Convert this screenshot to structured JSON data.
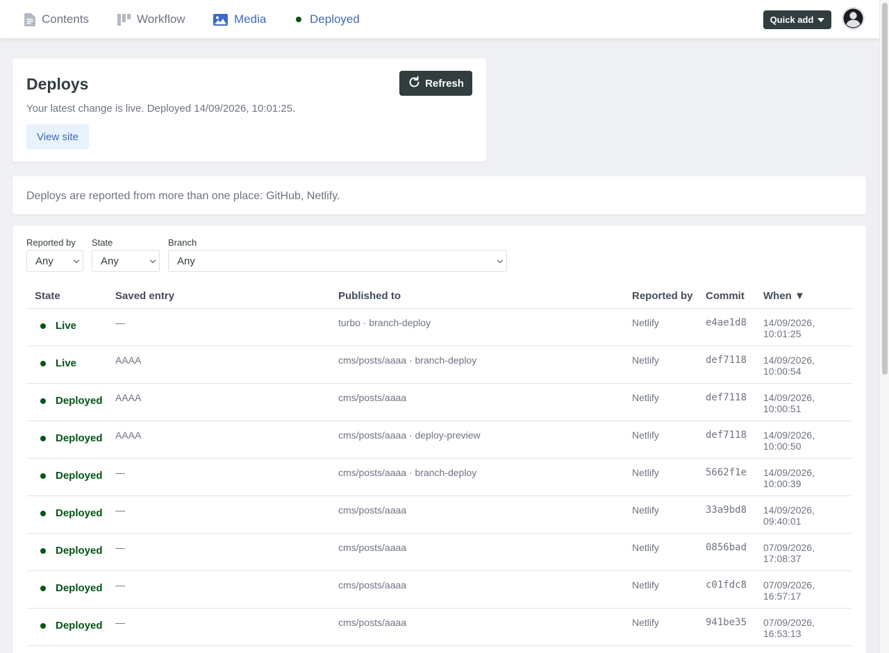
{
  "nav": {
    "items": [
      {
        "label": "Contents",
        "icon": "document-icon"
      },
      {
        "label": "Workflow",
        "icon": "workflow-icon"
      },
      {
        "label": "Media",
        "icon": "image-icon"
      },
      {
        "label": "Deployed",
        "icon": "status-dot-icon"
      }
    ],
    "quick_add": "Quick add"
  },
  "deploys": {
    "title": "Deploys",
    "status": "Your latest change is live. Deployed 14/09/2026, 10:01:25.",
    "view_site": "View site",
    "refresh": "Refresh"
  },
  "info": "Deploys are reported from more than one place: GitHub, Netlify.",
  "filters": {
    "reported_by": {
      "label": "Reported by",
      "value": "Any"
    },
    "state": {
      "label": "State",
      "value": "Any"
    },
    "branch": {
      "label": "Branch",
      "value": "Any"
    }
  },
  "table": {
    "headers": {
      "state": "State",
      "saved_entry": "Saved entry",
      "published_to": "Published to",
      "reported_by": "Reported by",
      "commit": "Commit",
      "when": "When ▼"
    },
    "rows": [
      {
        "state": "Live",
        "entry": "—",
        "published": "turbo · branch-deploy",
        "reporter": "Netlify",
        "commit": "e4ae1d8",
        "when": "14/09/2026, 10:01:25"
      },
      {
        "state": "Live",
        "entry": "AAAA",
        "published": "cms/posts/aaaa · branch-deploy",
        "reporter": "Netlify",
        "commit": "def7118",
        "when": "14/09/2026, 10:00:54"
      },
      {
        "state": "Deployed",
        "entry": "AAAA",
        "published": "cms/posts/aaaa",
        "reporter": "Netlify",
        "commit": "def7118",
        "when": "14/09/2026, 10:00:51"
      },
      {
        "state": "Deployed",
        "entry": "AAAA",
        "published": "cms/posts/aaaa · deploy-preview",
        "reporter": "Netlify",
        "commit": "def7118",
        "when": "14/09/2026, 10:00:50"
      },
      {
        "state": "Deployed",
        "entry": "—",
        "published": "cms/posts/aaaa · branch-deploy",
        "reporter": "Netlify",
        "commit": "5662f1e",
        "when": "14/09/2026, 10:00:39"
      },
      {
        "state": "Deployed",
        "entry": "—",
        "published": "cms/posts/aaaa",
        "reporter": "Netlify",
        "commit": "33a9bd8",
        "when": "14/09/2026, 09:40:01"
      },
      {
        "state": "Deployed",
        "entry": "—",
        "published": "cms/posts/aaaa",
        "reporter": "Netlify",
        "commit": "0856bad",
        "when": "07/09/2026, 17:08:37"
      },
      {
        "state": "Deployed",
        "entry": "—",
        "published": "cms/posts/aaaa",
        "reporter": "Netlify",
        "commit": "c01fdc8",
        "when": "07/09/2026, 16:57:17"
      },
      {
        "state": "Deployed",
        "entry": "—",
        "published": "cms/posts/aaaa",
        "reporter": "Netlify",
        "commit": "941be35",
        "when": "07/09/2026, 16:53:13"
      }
    ]
  },
  "colors": {
    "accent": "#3a69c7",
    "status_green": "#005614",
    "dark_button": "#313d3e"
  }
}
